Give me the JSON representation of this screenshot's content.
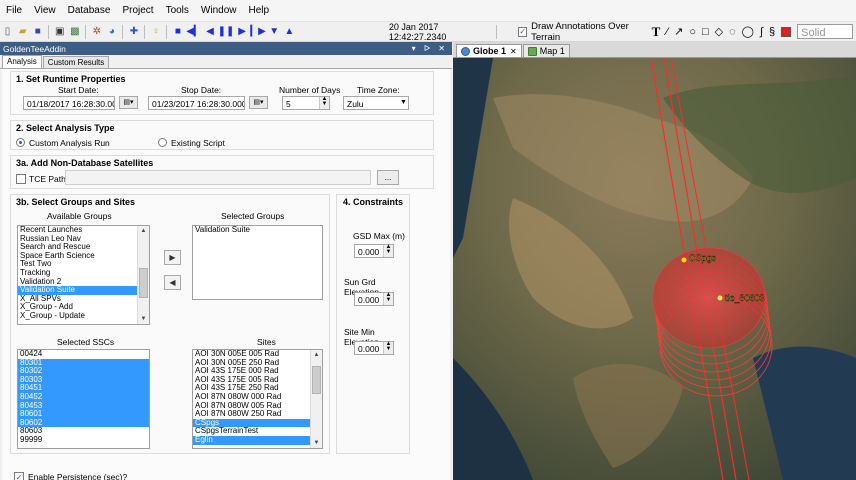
{
  "menu": [
    "File",
    "View",
    "Database",
    "Project",
    "Tools",
    "Window",
    "Help"
  ],
  "toolbar": {
    "datetime": "20 Jan 2017 12:42:27.2340",
    "draw_annotations_label": "Draw Annotations Over Terrain",
    "draw_annotations_checked": true,
    "line_style": "Solid",
    "color": "#e0201e",
    "icons": [
      "new-icon",
      "open-icon",
      "save-icon",
      "database-icon",
      "database-add-icon",
      "satellite-icon",
      "globe-icon",
      "crosshair-icon",
      "lightbulb-icon",
      "stop-icon",
      "step-back-icon",
      "rewind-icon",
      "pause-icon",
      "play-icon",
      "step-forward-icon",
      "fast-forward-icon",
      "eject-icon"
    ],
    "draw_tools": [
      "text-tool-icon",
      "line-tool-icon",
      "arrow-tool-icon",
      "circle-tool-icon",
      "rectangle-tool-icon",
      "polygon-tool-icon",
      "arc-tool-icon",
      "ellipse-tool-icon",
      "curve-tool-icon",
      "freehand-tool-icon"
    ]
  },
  "panel": {
    "title": "GoldenTeeAddin",
    "tabs": [
      "Analysis",
      "Custom Results"
    ]
  },
  "section1": {
    "title": "1. Set Runtime Properties",
    "start_label": "Start Date:",
    "start_value": "01/18/2017 16:28:30.000",
    "stop_label": "Stop Date:",
    "stop_value": "01/23/2017 16:28:30.000",
    "days_label": "Number of Days",
    "days_value": "5",
    "tz_label": "Time Zone:",
    "tz_value": "Zulu"
  },
  "section2": {
    "title": "2. Select Analysis Type",
    "opt_custom": "Custom Analysis Run",
    "opt_script": "Existing Script"
  },
  "section3a": {
    "title": "3a. Add Non-Database Satellites",
    "tce_label": "TCE Path:",
    "browse": "..."
  },
  "section3b": {
    "title": "3b. Select Groups and Sites",
    "available_label": "Available Groups",
    "available": [
      "Recent Launches",
      "Russian Leo Nav",
      "Search and Rescue",
      "Space Earth Science",
      "Test Two",
      "Tracking",
      "Validation 2",
      "Validation Suite",
      "X_All SPVs",
      "X_Group - Add",
      "X_Group - Update"
    ],
    "available_selected": 7,
    "selected_label": "Selected Groups",
    "selected": [
      "Validation Suite"
    ],
    "ssc_label": "Selected SSCs",
    "sscs": [
      "00424",
      "80301",
      "80302",
      "80303",
      "80451",
      "80452",
      "80453",
      "80601",
      "80602",
      "80603",
      "99999"
    ],
    "sscs_selected": [
      1,
      2,
      3,
      4,
      5,
      6,
      7,
      8
    ],
    "sites_label": "Sites",
    "sites": [
      "AOI 30N 005E 005 Rad",
      "AOI 30N 005E 250 Rad",
      "AOI 43S 175E 000 Rad",
      "AOI 43S 175E 005 Rad",
      "AOI 43S 175E 250 Rad",
      "AOI 87N 080W 000 Rad",
      "AOI 87N 080W 005 Rad",
      "AOI 87N 080W 250 Rad",
      "CSpgs",
      "CSpgsTerrainTest",
      "Eglin"
    ],
    "sites_selected": [
      8,
      10
    ]
  },
  "section4": {
    "title": "4. Constraints",
    "gsd_label": "GSD Max (m)",
    "gsd_value": "0.000",
    "sun_label": "Sun Grd Elevation",
    "sun_value": "0.000",
    "site_label": "Site Min Elevation",
    "site_value": "0.000"
  },
  "persistence_label": "Enable Persistence (sec)?",
  "persistence_checked": true,
  "map": {
    "tabs": [
      "Globe 1",
      "Map 1"
    ],
    "labels": [
      "CSpgs",
      "tle_80603"
    ],
    "accent": "#ff2a2a"
  }
}
